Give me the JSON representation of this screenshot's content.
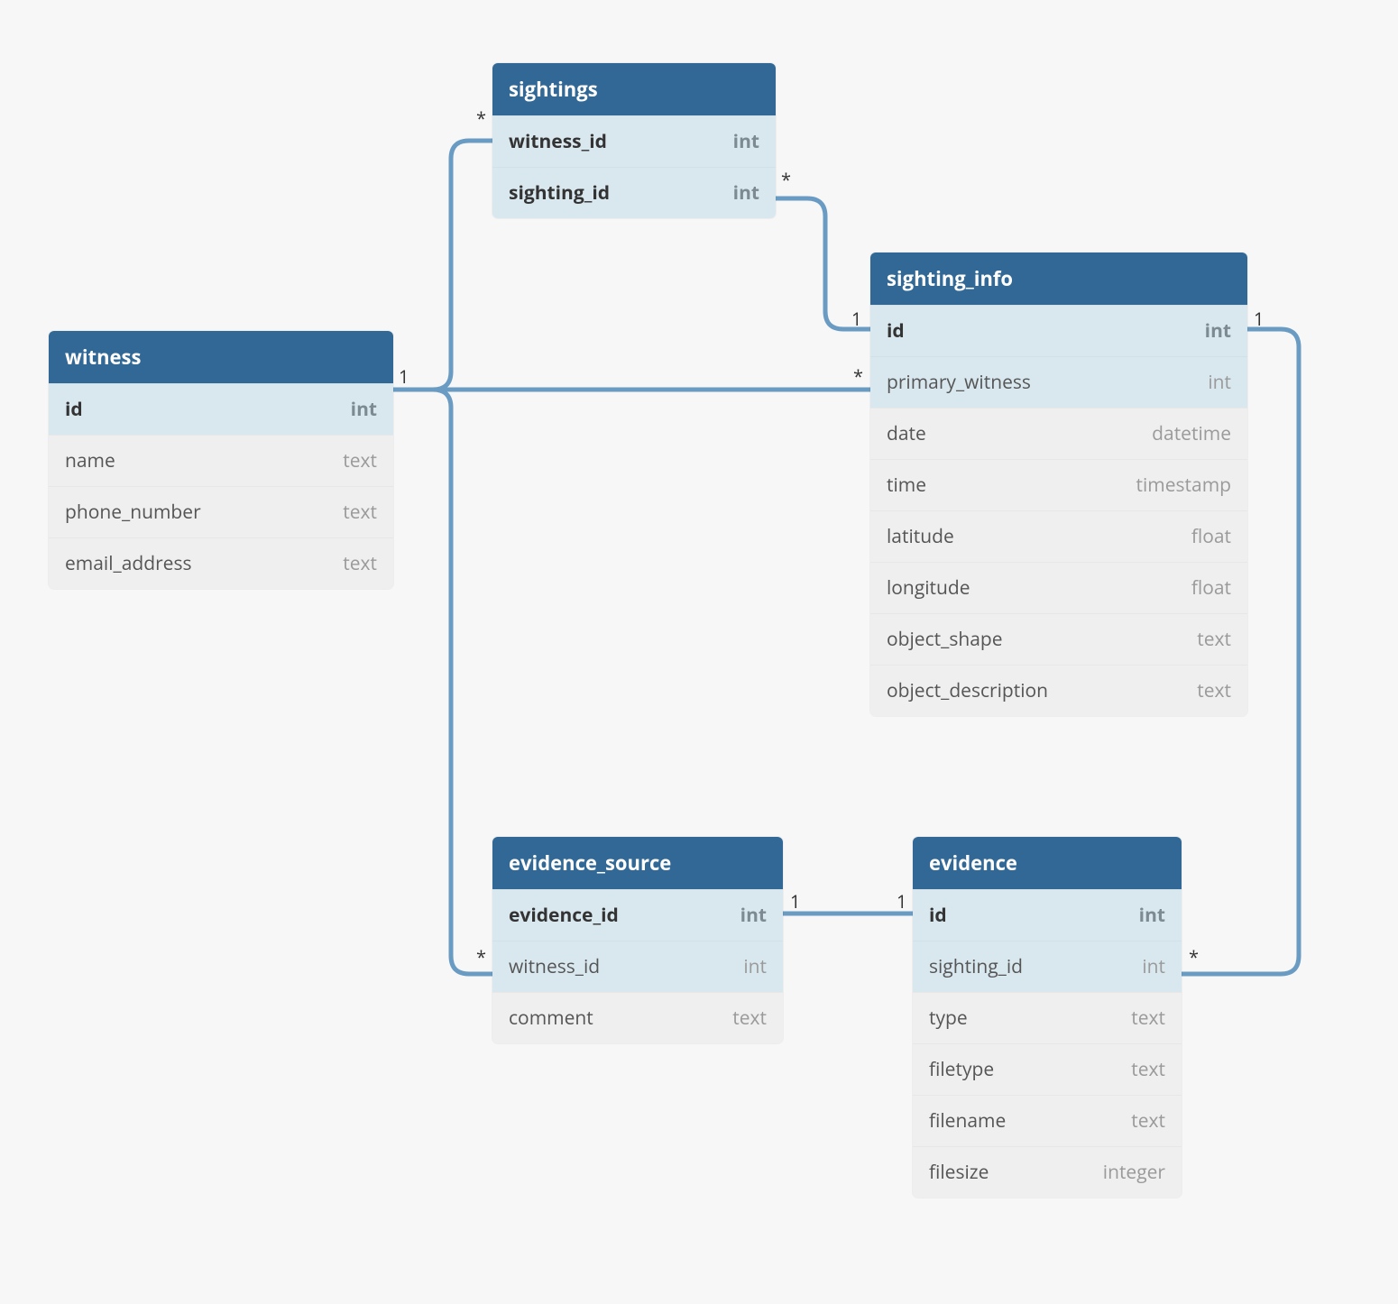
{
  "entities": {
    "witness": {
      "title": "witness",
      "fields": [
        {
          "name": "id",
          "type": "int",
          "pk": true
        },
        {
          "name": "name",
          "type": "text",
          "pk": false
        },
        {
          "name": "phone_number",
          "type": "text",
          "pk": false
        },
        {
          "name": "email_address",
          "type": "text",
          "pk": false
        }
      ]
    },
    "sightings": {
      "title": "sightings",
      "fields": [
        {
          "name": "witness_id",
          "type": "int",
          "pk": true
        },
        {
          "name": "sighting_id",
          "type": "int",
          "pk": true
        }
      ]
    },
    "sighting_info": {
      "title": "sighting_info",
      "fields": [
        {
          "name": "id",
          "type": "int",
          "pk": true
        },
        {
          "name": "primary_witness",
          "type": "int",
          "pk": false,
          "lightpk": true
        },
        {
          "name": "date",
          "type": "datetime",
          "pk": false
        },
        {
          "name": "time",
          "type": "timestamp",
          "pk": false
        },
        {
          "name": "latitude",
          "type": "float",
          "pk": false
        },
        {
          "name": "longitude",
          "type": "float",
          "pk": false
        },
        {
          "name": "object_shape",
          "type": "text",
          "pk": false
        },
        {
          "name": "object_description",
          "type": "text",
          "pk": false
        }
      ]
    },
    "evidence_source": {
      "title": "evidence_source",
      "fields": [
        {
          "name": "evidence_id",
          "type": "int",
          "pk": true
        },
        {
          "name": "witness_id",
          "type": "int",
          "pk": false,
          "lightpk": true
        },
        {
          "name": "comment",
          "type": "text",
          "pk": false
        }
      ]
    },
    "evidence": {
      "title": "evidence",
      "fields": [
        {
          "name": "id",
          "type": "int",
          "pk": true
        },
        {
          "name": "sighting_id",
          "type": "int",
          "pk": false,
          "lightpk": true
        },
        {
          "name": "type",
          "type": "text",
          "pk": false
        },
        {
          "name": "filetype",
          "type": "text",
          "pk": false
        },
        {
          "name": "filename",
          "type": "text",
          "pk": false
        },
        {
          "name": "filesize",
          "type": "integer",
          "pk": false
        }
      ]
    }
  },
  "cardinalities": {
    "witness_right": "1",
    "sightings_left": "*",
    "sightings_right": "*",
    "sighting_info_left_top": "1",
    "sighting_info_left_mid": "*",
    "sighting_info_right": "1",
    "evidence_source_left": "*",
    "evidence_source_right": "1",
    "evidence_left": "1",
    "evidence_right": "*"
  }
}
